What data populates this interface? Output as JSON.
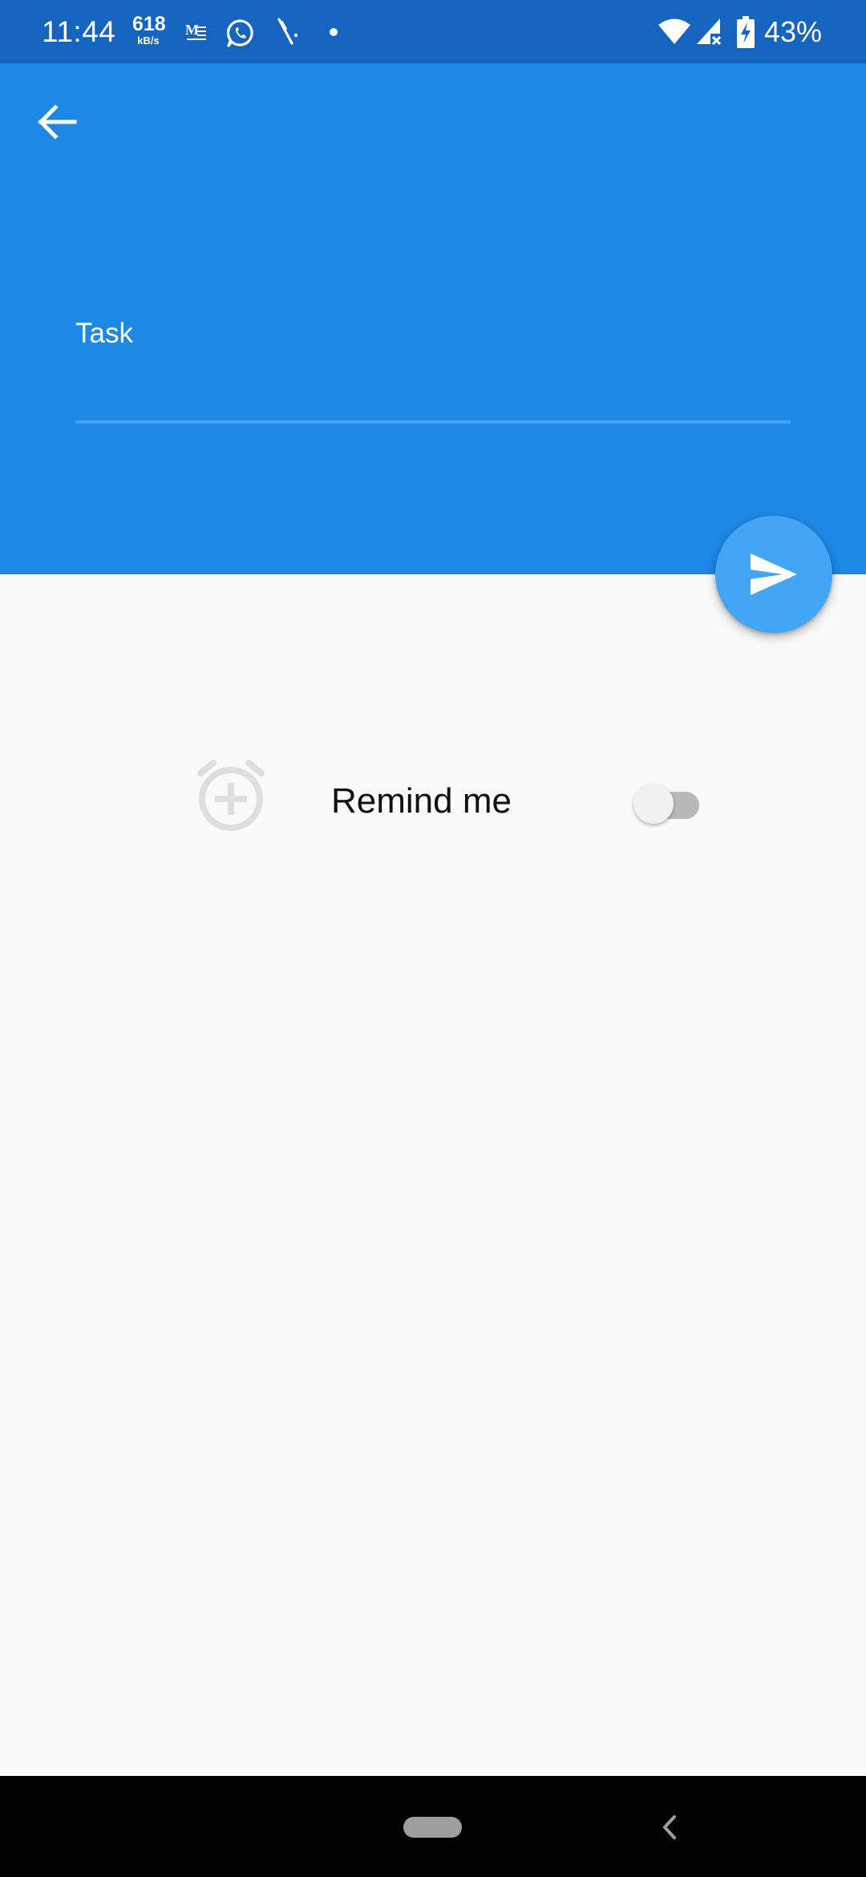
{
  "status_bar": {
    "time": "11:44",
    "net_speed_value": "618",
    "net_speed_unit": "kB/s",
    "battery_percent": "43%",
    "icons": [
      "gmail-icon",
      "whatsapp-icon",
      "feather-icon",
      "dot-icon",
      "wifi-icon",
      "cellular-signal-icon",
      "battery-charging-icon"
    ]
  },
  "header": {
    "back_icon": "arrow-left-icon"
  },
  "task_field": {
    "label": "Task",
    "value": ""
  },
  "fab": {
    "icon": "send-icon"
  },
  "reminder": {
    "icon": "alarm-add-icon",
    "label": "Remind me",
    "enabled": false
  },
  "nav_bar": {
    "home_icon": "home-pill-icon",
    "back_icon": "nav-back-icon"
  },
  "colors": {
    "status_bar": "#1565c0",
    "header": "#1e88e5",
    "fab": "#42a5f5",
    "underline": "#42a5f5",
    "background": "#fafafa"
  }
}
